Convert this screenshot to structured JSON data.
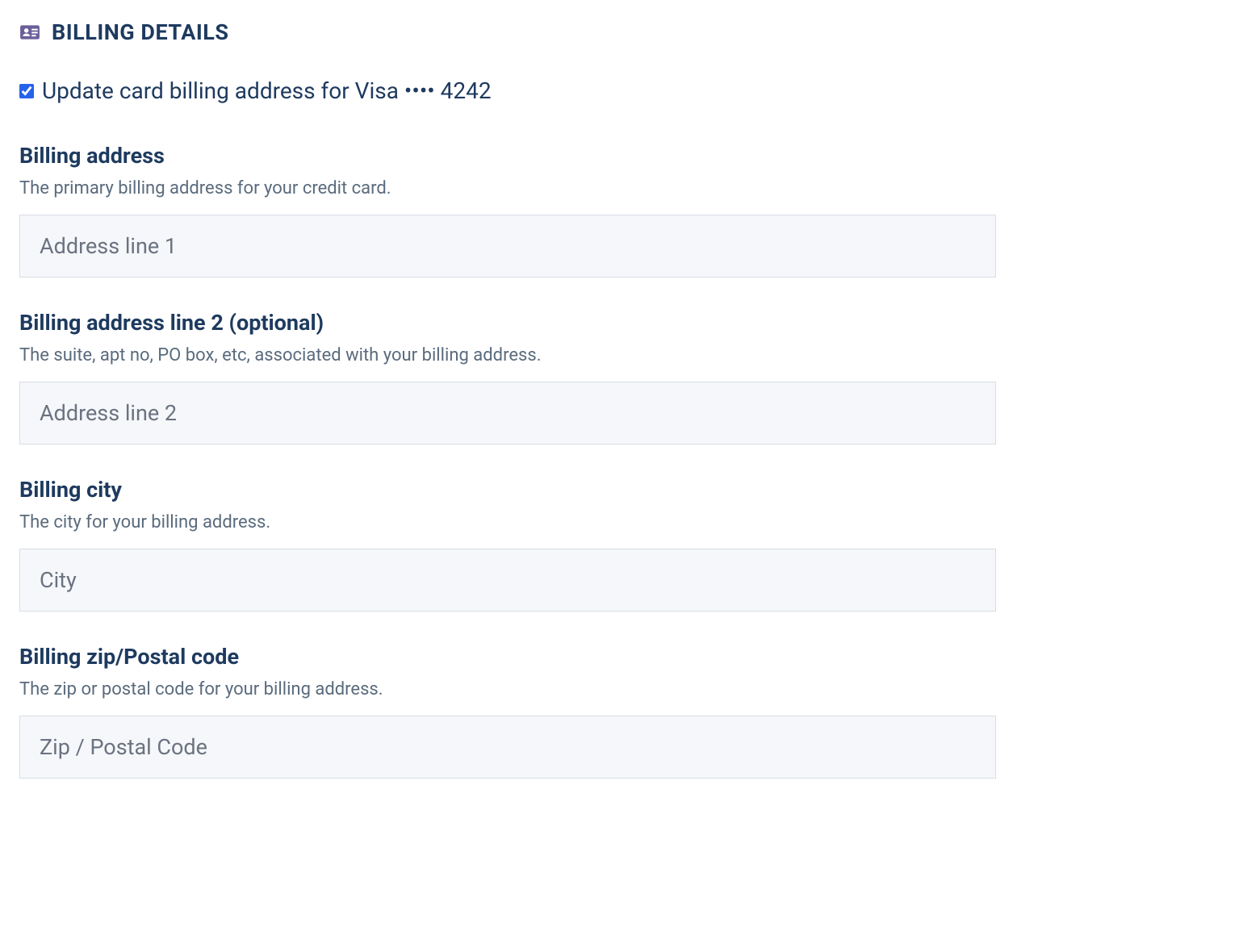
{
  "header": {
    "title": "BILLING DETAILS"
  },
  "update_checkbox": {
    "label": "Update card billing address for Visa •••• 4242",
    "checked": true
  },
  "fields": {
    "address1": {
      "label": "Billing address",
      "description": "The primary billing address for your credit card.",
      "placeholder": "Address line 1",
      "value": ""
    },
    "address2": {
      "label": "Billing address line 2 (optional)",
      "description": "The suite, apt no, PO box, etc, associated with your billing address.",
      "placeholder": "Address line 2",
      "value": ""
    },
    "city": {
      "label": "Billing city",
      "description": "The city for your billing address.",
      "placeholder": "City",
      "value": ""
    },
    "zip": {
      "label": "Billing zip/Postal code",
      "description": "The zip or postal code for your billing address.",
      "placeholder": "Zip / Postal Code",
      "value": ""
    }
  }
}
